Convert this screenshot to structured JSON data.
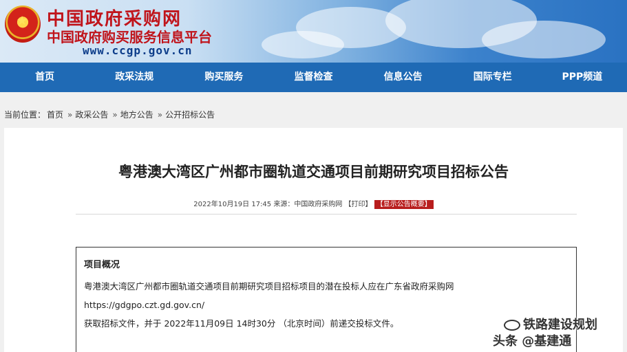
{
  "header": {
    "title": "中国政府采购网",
    "subtitle": "中国政府购买服务信息平台",
    "url": "www.ccgp.gov.cn"
  },
  "nav": [
    "首页",
    "政采法规",
    "购买服务",
    "监督检查",
    "信息公告",
    "国际专栏",
    "PPP频道"
  ],
  "breadcrumb": {
    "prefix": "当前位置：",
    "items": [
      "首页",
      "政采公告",
      "地方公告",
      "公开招标公告"
    ]
  },
  "article": {
    "title": "粤港澳大湾区广州都市圈轨道交通项目前期研究项目招标公告",
    "date": "2022年10月19日 17:45",
    "source_label": "来源：",
    "source": "中国政府采购网",
    "print": "【打印】",
    "summary_toggle": "【显示公告概要】"
  },
  "summary": {
    "heading": "项目概况",
    "line1": "粤港澳大湾区广州都市圈轨道交通项目前期研究项目招标项目的潜在投标人应在广东省政府采购网",
    "line2": "https://gdgpo.czt.gd.gov.cn/",
    "line3": "获取招标文件，并于 2022年11月09日 14时30分 （北京时间）前递交投标文件。"
  },
  "watermark": {
    "top": "铁路建设规划",
    "bottom": "头条 @基建通"
  }
}
